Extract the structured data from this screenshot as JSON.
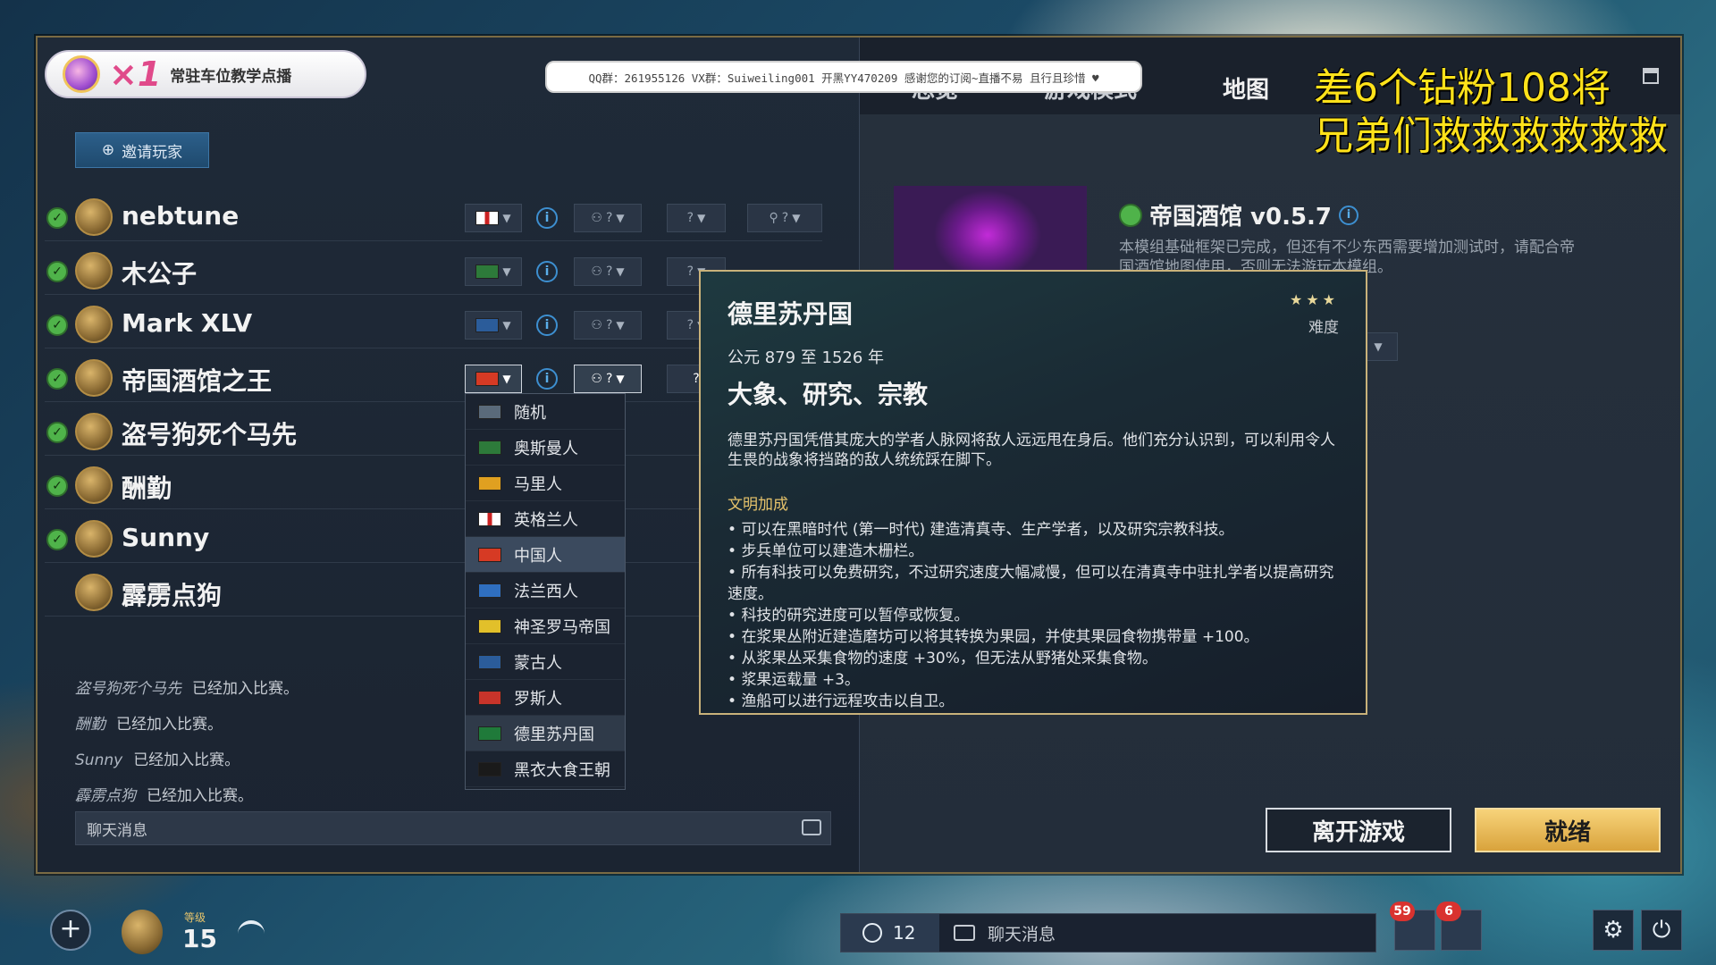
{
  "stream": {
    "badge_mult": "×1",
    "badge_text": "常驻车位教学点播",
    "qq_banner": "QQ群：261955126  VX群：Suiweiling001  开黑YY470209  感谢您的订阅~直播不易 且行且珍惜 ♥",
    "message_line1": "差6个钻粉108将",
    "message_line2": "兄弟们救救救救救救"
  },
  "lobby": {
    "invite_label": "邀请玩家",
    "players": [
      {
        "name": "nebtune",
        "ready": true
      },
      {
        "name": "木公子",
        "ready": true
      },
      {
        "name": "Mark XLV",
        "ready": true
      },
      {
        "name": "帝国酒馆之王",
        "ready": true
      },
      {
        "name": "盗号狗死个马先",
        "ready": true
      },
      {
        "name": "酬勤",
        "ready": true
      },
      {
        "name": "Sunny",
        "ready": true
      },
      {
        "name": "霹雳点狗",
        "ready": false
      }
    ],
    "team_value": "?",
    "position_value": "?",
    "color_value": "?"
  },
  "civ_dropdown": {
    "options": [
      "随机",
      "奥斯曼人",
      "马里人",
      "英格兰人",
      "中国人",
      "法兰西人",
      "神圣罗马帝国",
      "蒙古人",
      "罗斯人",
      "德里苏丹国",
      "黑衣大食王朝"
    ],
    "selected": "中国人",
    "hovered": "德里苏丹国"
  },
  "chat_log": [
    {
      "who": "盗号狗死个马先",
      "msg": "已经加入比赛。"
    },
    {
      "who": "酬勤",
      "msg": "已经加入比赛。"
    },
    {
      "who": "Sunny",
      "msg": "已经加入比赛。"
    },
    {
      "who": "霹雳点狗",
      "msg": "已经加入比赛。"
    }
  ],
  "chat_placeholder": "聊天消息",
  "right": {
    "tab_a": "总览",
    "tab_b": "游戏模式",
    "tab_map": "地图",
    "mod_title": "帝国酒馆 v0.5.7",
    "mod_desc": "本模组基础框架已完成，但还有不少东西需要增加测试时，请配合帝国酒馆地图使用，否则无法游玩本模组。"
  },
  "tooltip": {
    "name": "德里苏丹国",
    "stars": "★★★",
    "difficulty": "难度",
    "era": "公元 879 至 1526 年",
    "focus": "大象、研究、宗教",
    "desc": "德里苏丹国凭借其庞大的学者人脉网将敌人远远甩在身后。他们充分认识到，可以利用令人生畏的战象将挡路的敌人统统踩在脚下。",
    "bonus_title": "文明加成",
    "bonuses": [
      "可以在黑暗时代 (第一时代) 建造清真寺、生产学者，以及研究宗教科技。",
      "步兵单位可以建造木栅栏。",
      "所有科技可以免费研究，不过研究速度大幅减慢，但可以在清真寺中驻扎学者以提高研究速度。",
      "科技的研究进度可以暂停或恢复。",
      "在浆果丛附近建造磨坊可以将其转换为果园，并使其果园食物携带量 +100。",
      "从浆果丛采集食物的速度 +30%，但无法从野猪处采集食物。",
      "浆果运载量 +3。",
      "渔船可以进行远程攻击以自卫。"
    ]
  },
  "buttons": {
    "leave": "离开游戏",
    "ready": "就绪"
  },
  "hud": {
    "level_label": "等级",
    "level": "15",
    "friends_count": "12",
    "chat_label": "聊天消息",
    "notify_count": "59",
    "crown_count": "6"
  },
  "colors": {
    "accent_gold": "#d9a33c",
    "ready_green": "#4fb34a",
    "info_blue": "#3d8fd0",
    "stream_yellow": "#ffe21a"
  }
}
